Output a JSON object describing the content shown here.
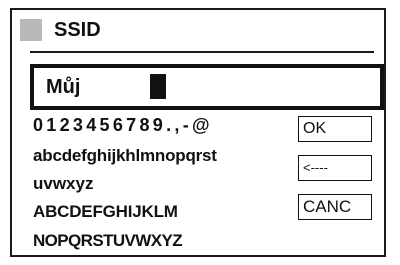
{
  "header": {
    "title": "SSID",
    "icon": "square-icon"
  },
  "entry": {
    "value": "Můj"
  },
  "keyboard": {
    "rows": [
      "0123456789.,-@",
      "abcdefghijkhlmnopqrst",
      "uvwxyz",
      "ABCDEFGHIJKLM",
      "NOPQRSTUVWXYZ"
    ]
  },
  "buttons": {
    "ok": "OK",
    "backspace": "<----",
    "cancel": "CANC"
  },
  "colors": {
    "frame": "#1a1a1a",
    "icon": "#b8b8b8",
    "background": "#ffffff"
  }
}
